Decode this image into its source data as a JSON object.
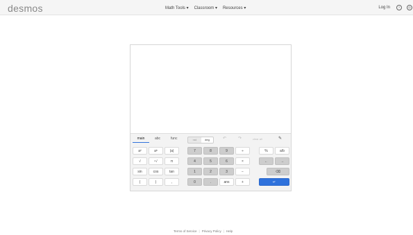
{
  "header": {
    "logo": "desmos",
    "nav": [
      {
        "label": "Math Tools",
        "caret": "▾"
      },
      {
        "label": "Classroom",
        "caret": "▾"
      },
      {
        "label": "Resources",
        "caret": "▾"
      }
    ],
    "login": "Log In",
    "help_icon": "?",
    "globe_icon": "◎"
  },
  "keypad": {
    "tabs": [
      "main",
      "abc",
      "func"
    ],
    "rad": "rad",
    "deg": "deg",
    "undo": "↶",
    "redo": "↷",
    "clear_all": "clear all",
    "settings_icon": "wrench-icon",
    "settings_glyph": "✎",
    "col1": [
      [
        "a²",
        "aᵇ",
        "|a|"
      ],
      [
        "√",
        "ⁿ√",
        "π"
      ],
      [
        "sin",
        "cos",
        "tan"
      ],
      [
        "(",
        ")",
        ","
      ]
    ],
    "col2": [
      [
        "7",
        "8",
        "9",
        "÷"
      ],
      [
        "4",
        "5",
        "6",
        "×"
      ],
      [
        "1",
        "2",
        "3",
        "−"
      ],
      [
        "0",
        ".",
        "ans",
        "+"
      ]
    ],
    "col3": [
      [
        "%",
        "a/b"
      ],
      [
        "←",
        "→"
      ],
      [
        "⌫"
      ],
      [
        "↵"
      ]
    ]
  },
  "footer": {
    "links": [
      "Terms of Service",
      "Privacy Policy",
      "Help"
    ]
  },
  "colors": {
    "accent": "#2f72dc",
    "topbar": "#f5f5f5"
  }
}
